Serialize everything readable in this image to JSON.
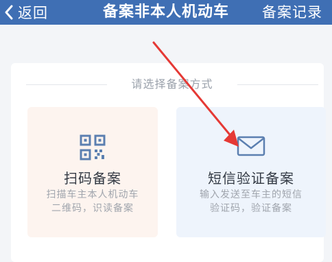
{
  "header": {
    "back_label": "返回",
    "title": "备案非本人机动车",
    "records_label": "备案记录"
  },
  "section": {
    "prompt": "请选择备案方式"
  },
  "options": [
    {
      "icon": "qr-code-icon",
      "label": "扫码备案",
      "desc_line1": "扫描车主本人机动车",
      "desc_line2": "二维码，识读备案"
    },
    {
      "icon": "envelope-icon",
      "label": "短信验证备案",
      "desc_line1": "输入发送至车主的短信",
      "desc_line2": "验证码，验证备案"
    }
  ],
  "colors": {
    "header_bg": "#3f6fb4",
    "accent_icon": "#5b7fb0",
    "annotation_arrow": "#e53935"
  }
}
